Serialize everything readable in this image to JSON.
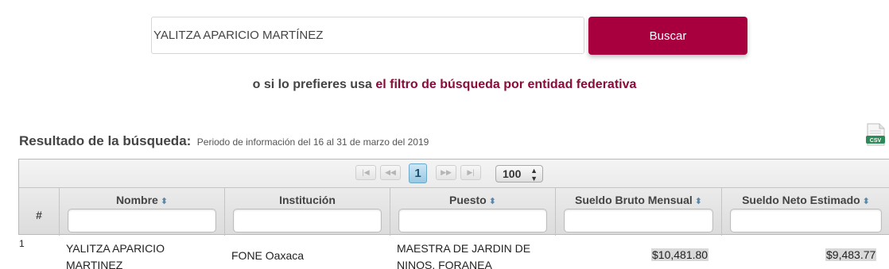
{
  "search": {
    "value": "YALITZA APARICIO MARTÍNEZ",
    "button_label": "Buscar"
  },
  "filter": {
    "prefix": "o si lo prefieres usa",
    "link_text": "el filtro de búsqueda por entidad federativa"
  },
  "results": {
    "title": "Resultado de la búsqueda:",
    "period": "Periodo de información del 16 al 31 de marzo del 2019",
    "csv_label": "CSV"
  },
  "pager": {
    "first": "|◀",
    "prev": "◀◀",
    "current_page": "1",
    "next": "▶▶",
    "last": "▶|",
    "page_size": "100"
  },
  "table": {
    "columns": {
      "index": "#",
      "nombre": "Nombre",
      "institucion": "Institución",
      "puesto": "Puesto",
      "bruto": "Sueldo Bruto Mensual",
      "neto": "Sueldo Neto Estimado"
    },
    "rows": [
      {
        "num": "1",
        "nombre": "YALITZA APARICIO MARTINEZ",
        "institucion": "FONE Oaxaca",
        "puesto": "MAESTRA DE JARDIN DE NINOS, FORANEA",
        "bruto": "$10,481.80",
        "neto": "$9,483.77"
      }
    ]
  },
  "colors": {
    "accent": "#a8003f",
    "link": "#8a0a3a"
  }
}
